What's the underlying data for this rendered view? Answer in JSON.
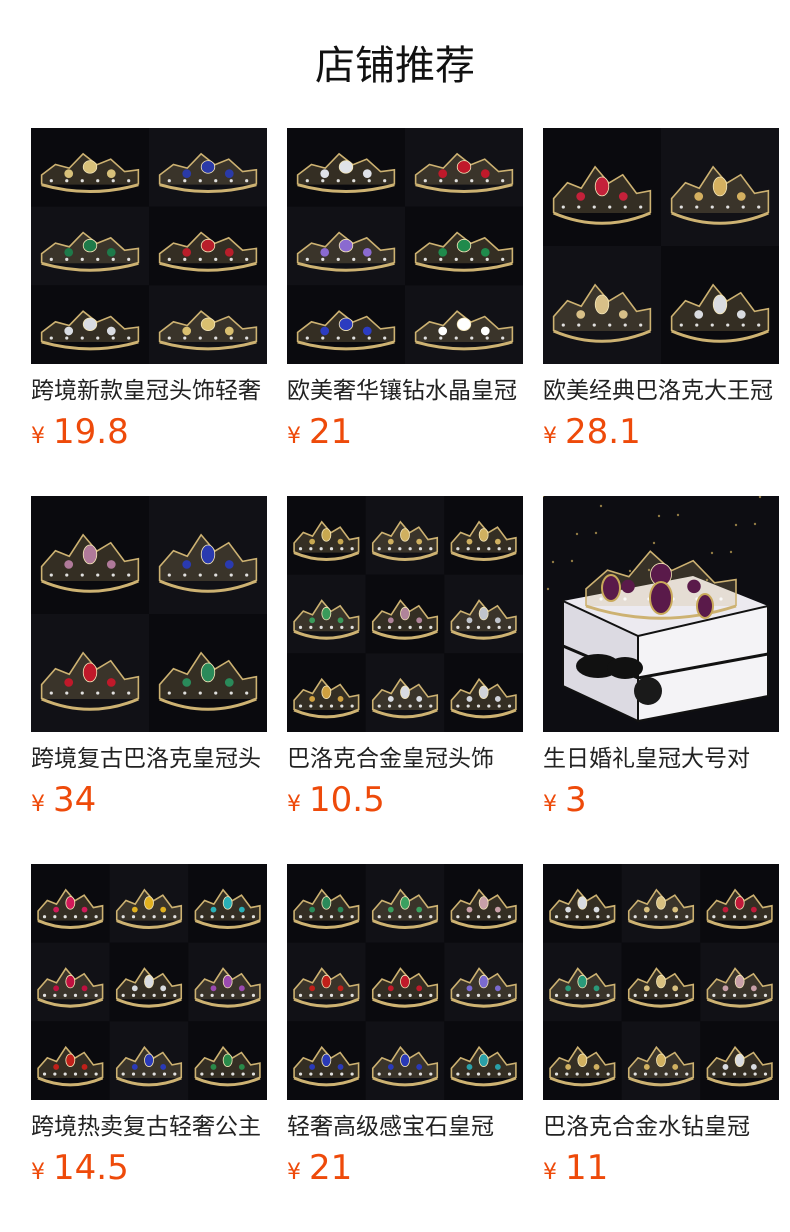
{
  "page": {
    "title": "店铺推荐"
  },
  "products": [
    {
      "name": "跨境新款皇冠头饰轻奢",
      "currency": "¥",
      "price": "19.8",
      "image": "crown-grid-2x3",
      "colors": [
        "#d8c17a",
        "#2a3aa8",
        "#1e7a4a",
        "#b81e2a",
        "#d9dce2",
        "#d9bf70"
      ]
    },
    {
      "name": "欧美奢华镶钻水晶皇冠",
      "currency": "¥",
      "price": "21",
      "image": "crown-grid-2x3",
      "colors": [
        "#dfe2e8",
        "#c0192a",
        "#8a6ad0",
        "#1f8a4c",
        "#2c3cc0",
        "#ffffff"
      ]
    },
    {
      "name": "欧美经典巴洛克大王冠",
      "currency": "¥",
      "price": "28.1",
      "image": "crown-grid-2x2",
      "colors": [
        "#c4213a",
        "#d4b060",
        "#d8c088",
        "#d9dbe0"
      ]
    },
    {
      "name": "跨境复古巴洛克皇冠头",
      "currency": "¥",
      "price": "34",
      "image": "crown-grid-2x2",
      "colors": [
        "#b07a9a",
        "#2a3ab0",
        "#c0192a",
        "#2a8a5a"
      ]
    },
    {
      "name": "巴洛克合金皇冠头饰",
      "currency": "¥",
      "price": "10.5",
      "image": "crown-grid-3x3",
      "colors": [
        "#c8a850",
        "#cfb060",
        "#cfb060",
        "#3a9a5a",
        "#b0849a",
        "#c0c4cc",
        "#cfa040",
        "#d8dbe2",
        "#d0d3da"
      ]
    },
    {
      "name": "生日婚礼皇冠大号对",
      "currency": "¥",
      "price": "3",
      "image": "crown-gift-box",
      "colors": [
        "#5a1a4a",
        "#c9a95a",
        "#ffffff"
      ]
    },
    {
      "name": "跨境热卖复古轻奢公主",
      "currency": "¥",
      "price": "14.5",
      "image": "crown-grid-3x3",
      "colors": [
        "#d01a5a",
        "#e0b020",
        "#2ab0b8",
        "#c01040",
        "#d8dbe0",
        "#9a4ab0",
        "#c0201a",
        "#2a3ab8",
        "#2a8a4a"
      ]
    },
    {
      "name": "轻奢高级感宝石皇冠",
      "currency": "¥",
      "price": "21",
      "image": "crown-grid-3x3",
      "colors": [
        "#2a8a5a",
        "#3aa060",
        "#c8a0a8",
        "#c0201a",
        "#c01a2a",
        "#7a6ad0",
        "#2a3ab8",
        "#2a3ab8",
        "#2aa0a8"
      ]
    },
    {
      "name": "巴洛克合金水钻皇冠",
      "currency": "¥",
      "price": "11",
      "image": "crown-grid-3x3",
      "colors": [
        "#d8dbe0",
        "#d8c080",
        "#c01a3a",
        "#2a9a7a",
        "#d8c080",
        "#c8a0a8",
        "#d0b060",
        "#d0b060",
        "#d8dbe0"
      ]
    }
  ]
}
